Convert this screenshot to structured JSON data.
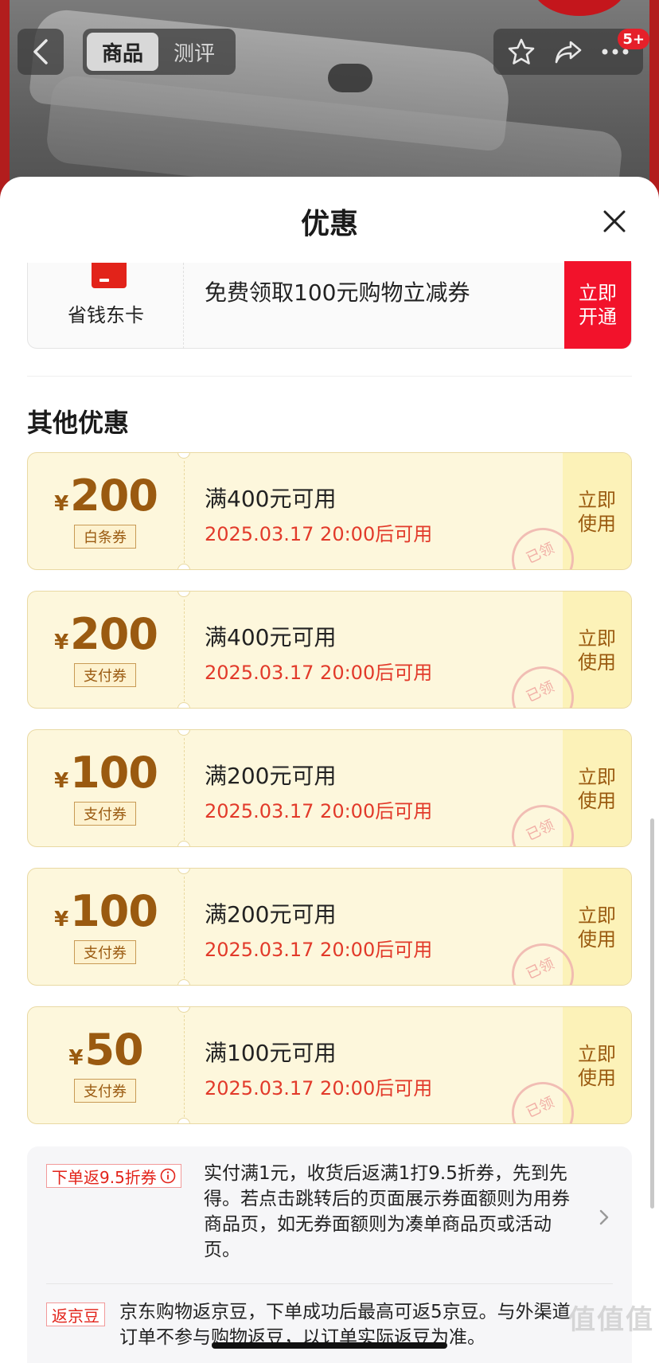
{
  "header": {
    "tabs": [
      {
        "label": "商品"
      },
      {
        "label": "测评"
      }
    ],
    "badge": "5+"
  },
  "sheet": {
    "title": "优惠",
    "member_card": {
      "label": "省钱东卡",
      "text": "免费领取100元购物立减券",
      "cta_line1": "立即",
      "cta_line2": "开通"
    },
    "section_title": "其他优惠",
    "coupons": [
      {
        "currency": "¥",
        "amount": "200",
        "type": "白条券",
        "condition": "满400元可用",
        "time": "2025.03.17 20:00后可用",
        "use_line1": "立即",
        "use_line2": "使用",
        "stamp": "已领"
      },
      {
        "currency": "¥",
        "amount": "200",
        "type": "支付券",
        "condition": "满400元可用",
        "time": "2025.03.17 20:00后可用",
        "use_line1": "立即",
        "use_line2": "使用",
        "stamp": "已领"
      },
      {
        "currency": "¥",
        "amount": "100",
        "type": "支付券",
        "condition": "满200元可用",
        "time": "2025.03.17 20:00后可用",
        "use_line1": "立即",
        "use_line2": "使用",
        "stamp": "已领"
      },
      {
        "currency": "¥",
        "amount": "100",
        "type": "支付券",
        "condition": "满200元可用",
        "time": "2025.03.17 20:00后可用",
        "use_line1": "立即",
        "use_line2": "使用",
        "stamp": "已领"
      },
      {
        "currency": "¥",
        "amount": "50",
        "type": "支付券",
        "condition": "满100元可用",
        "time": "2025.03.17 20:00后可用",
        "use_line1": "立即",
        "use_line2": "使用",
        "stamp": "已领"
      }
    ],
    "rebate": {
      "tag": "下单返9.5折券",
      "text": "实付满1元，收货后返满1打9.5折券，先到先得。若点击跳转后的页面展示券面额则为用券商品页，如无券面额则为凑单商品页或活动页。"
    },
    "beans": {
      "tag": "返京豆",
      "text": "京东购物返京豆，下单成功后最高可返5京豆。与外渠道订单不参与购物返豆，以订单实际返豆为准。"
    }
  },
  "watermark": "值值值",
  "colors": {
    "accent_red": "#e2231a",
    "coupon_bg": "#fdf7dc",
    "coupon_brown": "#9a5a10",
    "time_red": "#e23a2a"
  }
}
